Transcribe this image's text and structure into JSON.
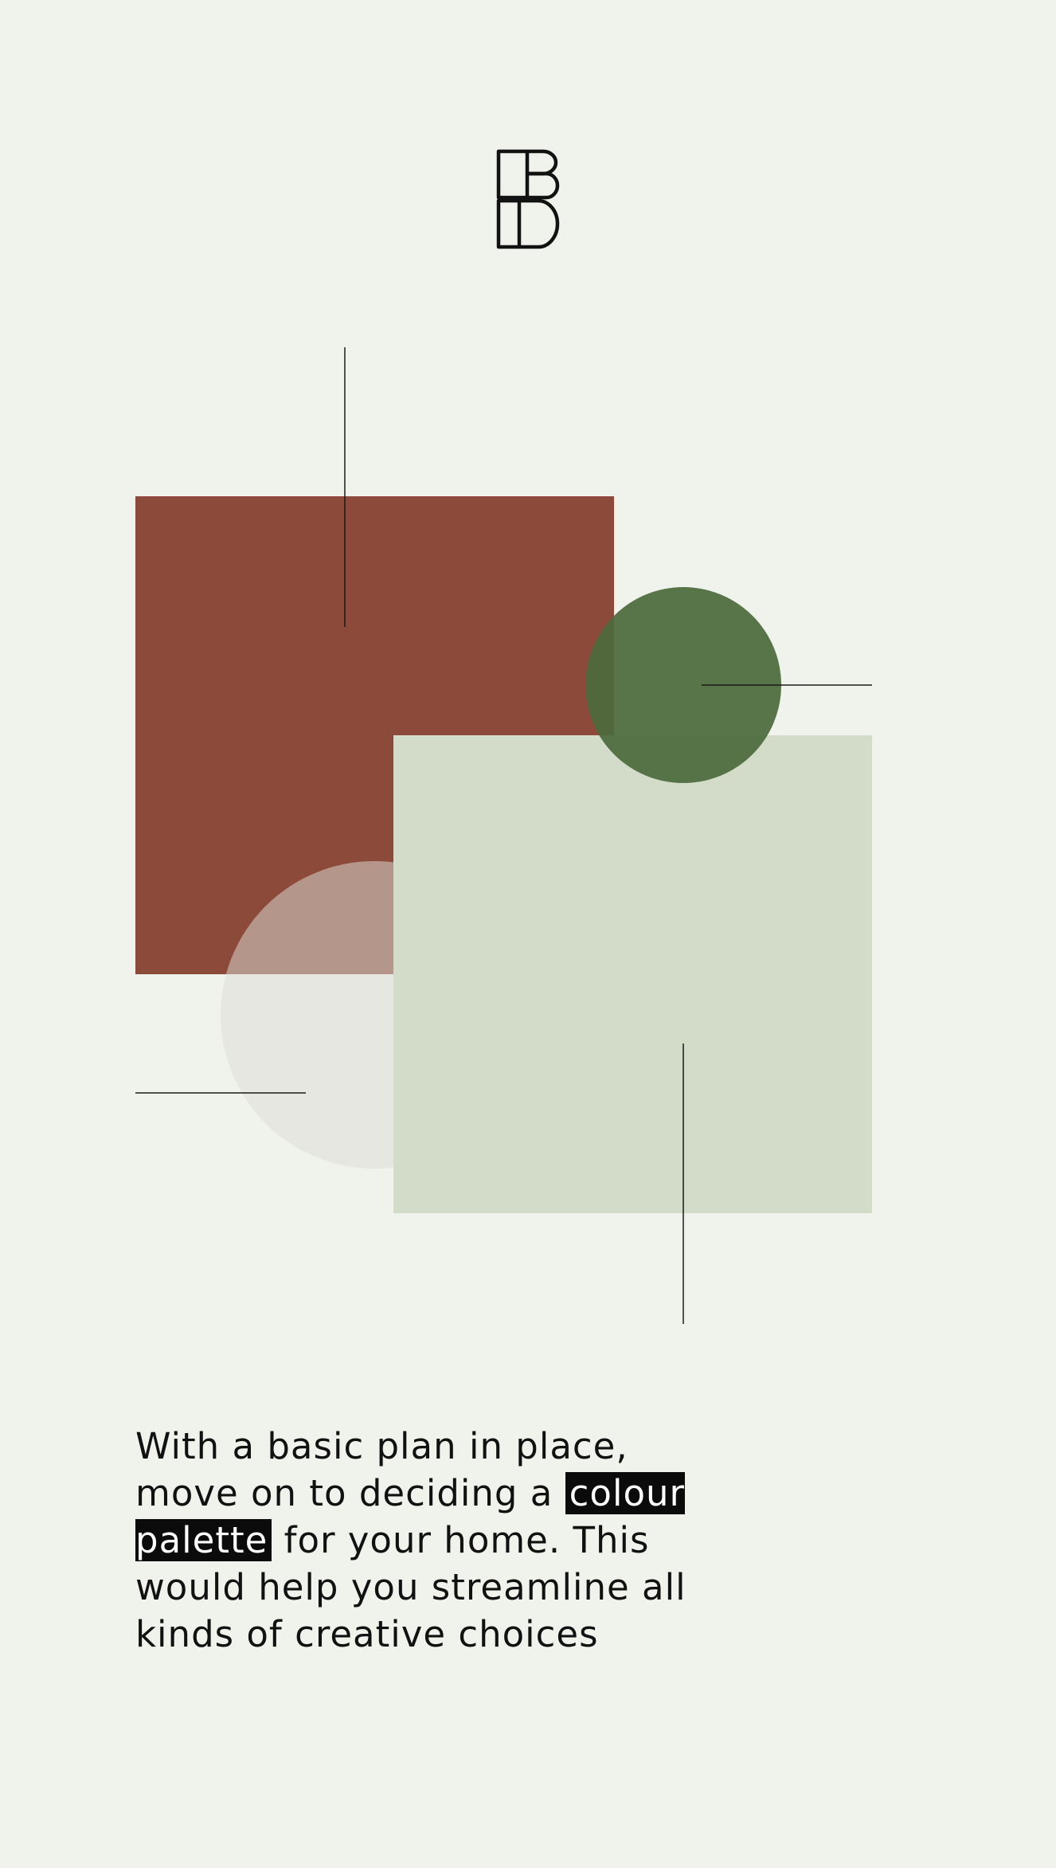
{
  "brand": {
    "logo_icon": "bd-monogram-logo"
  },
  "palette": {
    "background": "#f0f3ec",
    "terracotta": "#8b4a3a",
    "moss_green": "#4b6a3c",
    "sage": "#d3dbc9",
    "stone": "#dcdcd6",
    "line": "#1a1a1a"
  },
  "caption": {
    "text_before": "With a basic plan in place, move on to deciding a",
    "highlight": "colour palette",
    "text_after": "for your home. This would help you streamline all kinds of creative choices"
  }
}
